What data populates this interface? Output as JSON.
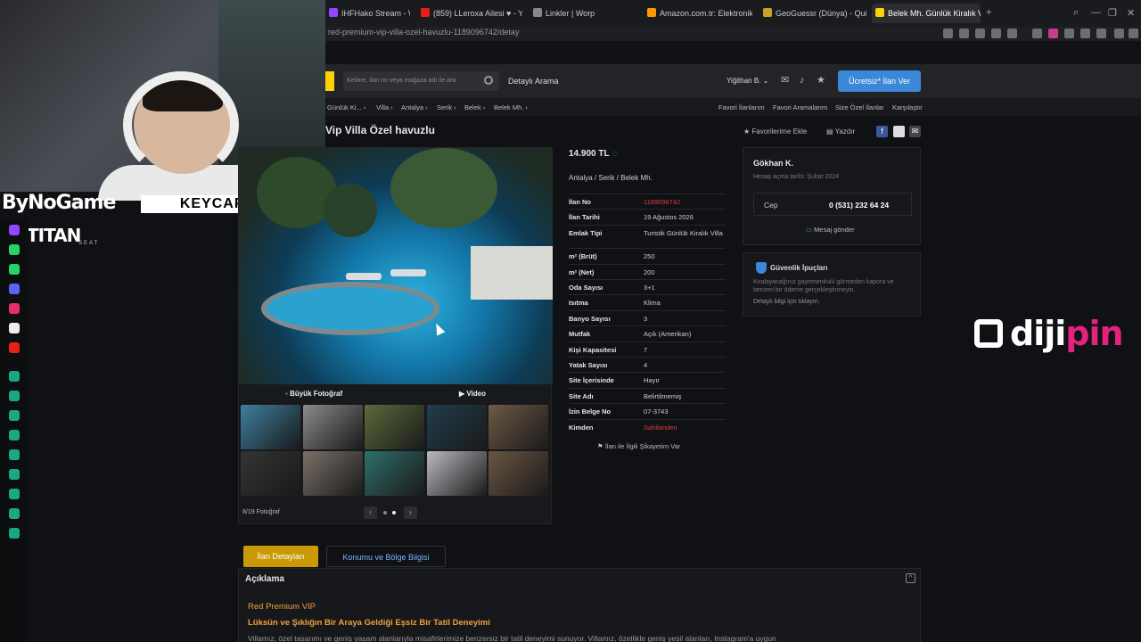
{
  "browser": {
    "tabs": [
      {
        "label": "IHFHako Stream - Wat",
        "color": "#9146ff"
      },
      {
        "label": "(859) LLeroxa Ailesi ♥ - Y",
        "color": "#e62117"
      },
      {
        "label": "Linkler | Worp",
        "color": "#888888"
      },
      {
        "label": "Amazon.com.tr: Elektronik",
        "color": "#ff9900"
      },
      {
        "label": "GeoGuessr (Dünya) - Quiz",
        "color": "#c9a227"
      },
      {
        "label": "Belek Mh. Günlük Kiralık V",
        "color": "#ffd100"
      }
    ],
    "url": "red-premium-vip-villa-ozel-havuzlu-1189096742/detay"
  },
  "overlay": {
    "sponsors": [
      "ByNoGame",
      "KEYCAPS",
      "TITAN",
      "SEAT"
    ],
    "dijipin_a": "diji",
    "dijipin_b": "pin"
  },
  "header": {
    "search_placeholder": "Kelime, ilan no veya mağaza adı ile ara",
    "detail_search": "Detaylı Arama",
    "user": "Yiğithan B. ⌄",
    "post_button": "Ücretsiz* İlan Ver"
  },
  "breadcrumbs": [
    "Günlük Ki... ›",
    "Villa ›",
    "Antalya ›",
    "Serik ›",
    "Belek ›",
    "Belek Mh. ›"
  ],
  "top_links": [
    "Favori İlanlarım",
    "Favori Aramalarım",
    "Size Özel İlanlar",
    "Karşılaştır"
  ],
  "listing": {
    "title": "Vip Villa Özel havuzlu",
    "add_favorite": "★ Favorilerime Ekle",
    "print": "Yazdır",
    "price": "14.900 TL",
    "location": "Antalya  /  Serik  /  Belek Mh.",
    "details": [
      {
        "k": "İlan No",
        "v": "1189096742",
        "red": true
      },
      {
        "k": "İlan Tarihi",
        "v": "19 Ağustos 2026"
      },
      {
        "k": "Emlak Tipi",
        "v": "Turistik Günlük Kiralık Villa"
      },
      {
        "k": "m² (Brüt)",
        "v": "250"
      },
      {
        "k": "m² (Net)",
        "v": "200"
      },
      {
        "k": "Oda Sayısı",
        "v": "3+1"
      },
      {
        "k": "Isıtma",
        "v": "Klima"
      },
      {
        "k": "Banyo Sayısı",
        "v": "3"
      },
      {
        "k": "Mutfak",
        "v": "Açık (Amerikan)"
      },
      {
        "k": "Kişi Kapasitesi",
        "v": "7"
      },
      {
        "k": "Yatak Sayısı",
        "v": "4"
      },
      {
        "k": "Site İçerisinde",
        "v": "Hayır"
      },
      {
        "k": "Site Adı",
        "v": "Belirtilmemiş"
      },
      {
        "k": "İzin Belge No",
        "v": "07-3743"
      },
      {
        "k": "Kimden",
        "v": "Sahibinden",
        "red": true
      }
    ],
    "complaint": "İlan ile İlgili Şikayetim Var"
  },
  "gallery": {
    "big_photo": "Büyük Fotoğraf",
    "video": "Video",
    "count": "8/19 Fotoğraf",
    "thumbs": [
      "#3d7fa0",
      "#8a8a8a",
      "#5a6a3a",
      "#223d4d",
      "#6d5a45",
      "#343434",
      "#7a7169",
      "#2f6f6a",
      "#b9b9c0",
      "#6a5645"
    ]
  },
  "seller": {
    "name": "Gökhan K.",
    "since": "Hesap açma tarihi: Şubat 2024",
    "phone_label": "Cep",
    "phone": "0 (531) 232 64 24",
    "message": "Mesaj gönder"
  },
  "tips": {
    "title": "Güvenlik İpuçları",
    "text": "Kiralayacağınız gayrimenkulü görmeden kapora ve benzeri bir ödeme gerçekleştirmeyin.",
    "link": "Detaylı bilgi için tıklayın."
  },
  "bottom_tabs": [
    "İlan Detayları",
    "Konumu ve Bölge Bilgisi"
  ],
  "description": {
    "title": "Açıklama",
    "line1": "Red Premium VIP",
    "line2": "Lüksün ve Şıklığın Bir Araya Geldiği Eşsiz Bir Tatil Deneyimi",
    "line3": "Villamız, özel tasarımı ve geniş yaşam alanlarıyla misafirlerimize benzersiz bir tatil deneyimi sunuyor. Villamız, özellikle geniş yeşil alanları, Instagram'a uygun"
  }
}
